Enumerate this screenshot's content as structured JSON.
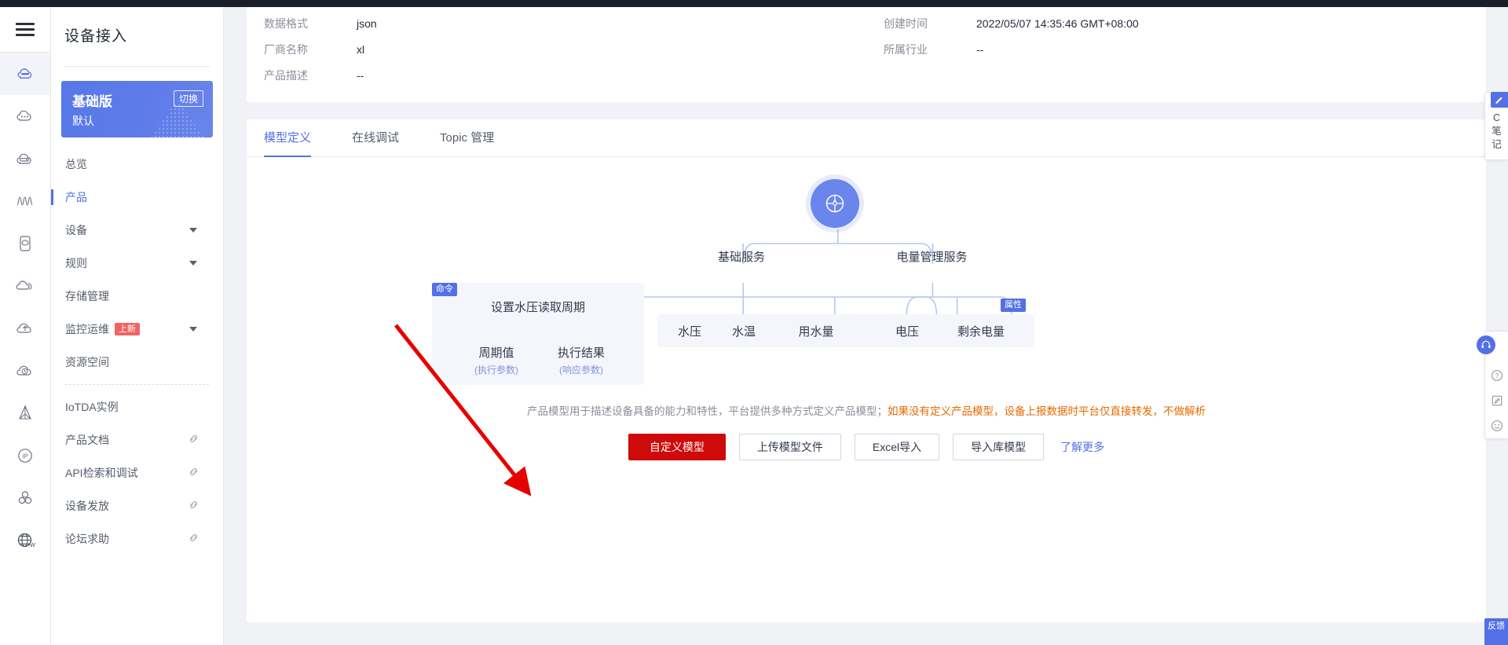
{
  "window": {
    "title": "设备接入"
  },
  "rail": {
    "burger": "menu-icon",
    "items": [
      {
        "icon": "cloud-device-icon",
        "active": true
      },
      {
        "icon": "cloud-dots-icon",
        "active": false
      },
      {
        "icon": "cloud-server-icon",
        "active": false
      },
      {
        "icon": "wave-chart-icon",
        "active": false
      },
      {
        "icon": "device-card-icon",
        "active": false
      },
      {
        "icon": "cloud-double-icon",
        "active": false
      },
      {
        "icon": "cloud-upload-icon",
        "active": false
      },
      {
        "icon": "cloud-clock-icon",
        "active": false
      },
      {
        "icon": "pyramid-icon",
        "active": false
      },
      {
        "icon": "ip-circle-icon",
        "active": false
      },
      {
        "icon": "cluster-icon",
        "active": false
      },
      {
        "icon": "globe-w-icon",
        "active": false
      }
    ]
  },
  "sidebar": {
    "title": "设备接入",
    "edition": {
      "name": "基础版",
      "switch_label": "切换",
      "instance": "默认"
    },
    "items": [
      {
        "label": "总览",
        "active": false,
        "caret": false,
        "badge": "",
        "link": false
      },
      {
        "label": "产品",
        "active": true,
        "caret": false,
        "badge": "",
        "link": false
      },
      {
        "label": "设备",
        "active": false,
        "caret": true,
        "badge": "",
        "link": false
      },
      {
        "label": "规则",
        "active": false,
        "caret": true,
        "badge": "",
        "link": false
      },
      {
        "label": "存储管理",
        "active": false,
        "caret": false,
        "badge": "",
        "link": false
      },
      {
        "label": "监控运维",
        "active": false,
        "caret": true,
        "badge": "上新",
        "link": false
      },
      {
        "label": "资源空间",
        "active": false,
        "caret": false,
        "badge": "",
        "link": false
      },
      {
        "label": "IoTDA实例",
        "active": false,
        "caret": false,
        "badge": "",
        "link": false,
        "divider_before": true
      },
      {
        "label": "产品文档",
        "active": false,
        "caret": false,
        "badge": "",
        "link": true
      },
      {
        "label": "API检索和调试",
        "active": false,
        "caret": false,
        "badge": "",
        "link": true
      },
      {
        "label": "设备发放",
        "active": false,
        "caret": false,
        "badge": "",
        "link": true
      },
      {
        "label": "论坛求助",
        "active": false,
        "caret": false,
        "badge": "",
        "link": true
      }
    ]
  },
  "info": {
    "left": [
      {
        "label": "数据格式",
        "value": "json"
      },
      {
        "label": "厂商名称",
        "value": "xl"
      },
      {
        "label": "产品描述",
        "value": "--"
      }
    ],
    "right": [
      {
        "label": "创建时间",
        "value": "2022/05/07 14:35:46 GMT+08:00"
      },
      {
        "label": "所属行业",
        "value": "--"
      }
    ]
  },
  "tabs": [
    {
      "label": "模型定义",
      "active": true
    },
    {
      "label": "在线调试",
      "active": false
    },
    {
      "label": "Topic 管理",
      "active": false
    }
  ],
  "model_tree": {
    "root_icon": "product-model-icon",
    "services": [
      {
        "label": "基础服务"
      },
      {
        "label": "电量管理服务"
      }
    ],
    "command": {
      "tag": "命令",
      "name": "设置水压读取周期",
      "params": [
        {
          "name": "周期值",
          "sub": "(执行参数)"
        },
        {
          "name": "执行结果",
          "sub": "(响应参数)"
        }
      ]
    },
    "properties": {
      "tag": "属性",
      "basic": [
        "水压",
        "水温",
        "用水量"
      ],
      "power": [
        "电压",
        "剩余电量"
      ]
    }
  },
  "footer": {
    "description_plain": "产品模型用于描述设备具备的能力和特性，平台提供多种方式定义产品模型；",
    "description_warn": "如果没有定义产品模型，设备上报数据时平台仅直接转发，不做解析",
    "buttons": [
      {
        "label": "自定义模型",
        "style": "primary"
      },
      {
        "label": "上传模型文件",
        "style": "default"
      },
      {
        "label": "Excel导入",
        "style": "default"
      },
      {
        "label": "导入库模型",
        "style": "default"
      }
    ],
    "learn_more": "了解更多"
  },
  "right_dock": {
    "note_panel": {
      "badge_icon": "pencil-note-icon",
      "chars": [
        "C",
        "笔",
        "记"
      ]
    },
    "items": [
      {
        "icon": "headset-support-icon"
      },
      {
        "icon": "question-help-icon"
      },
      {
        "icon": "feedback-edit-icon"
      },
      {
        "icon": "smiley-rating-icon"
      }
    ],
    "feedback_tab": "反馈"
  },
  "colors": {
    "accent": "#5370e6",
    "primary_button": "#cf0a0a",
    "warn_text": "#e56a00",
    "node_bg": "#f4f6fb",
    "badge_red": "#f36262",
    "annotation": "#e60000"
  }
}
